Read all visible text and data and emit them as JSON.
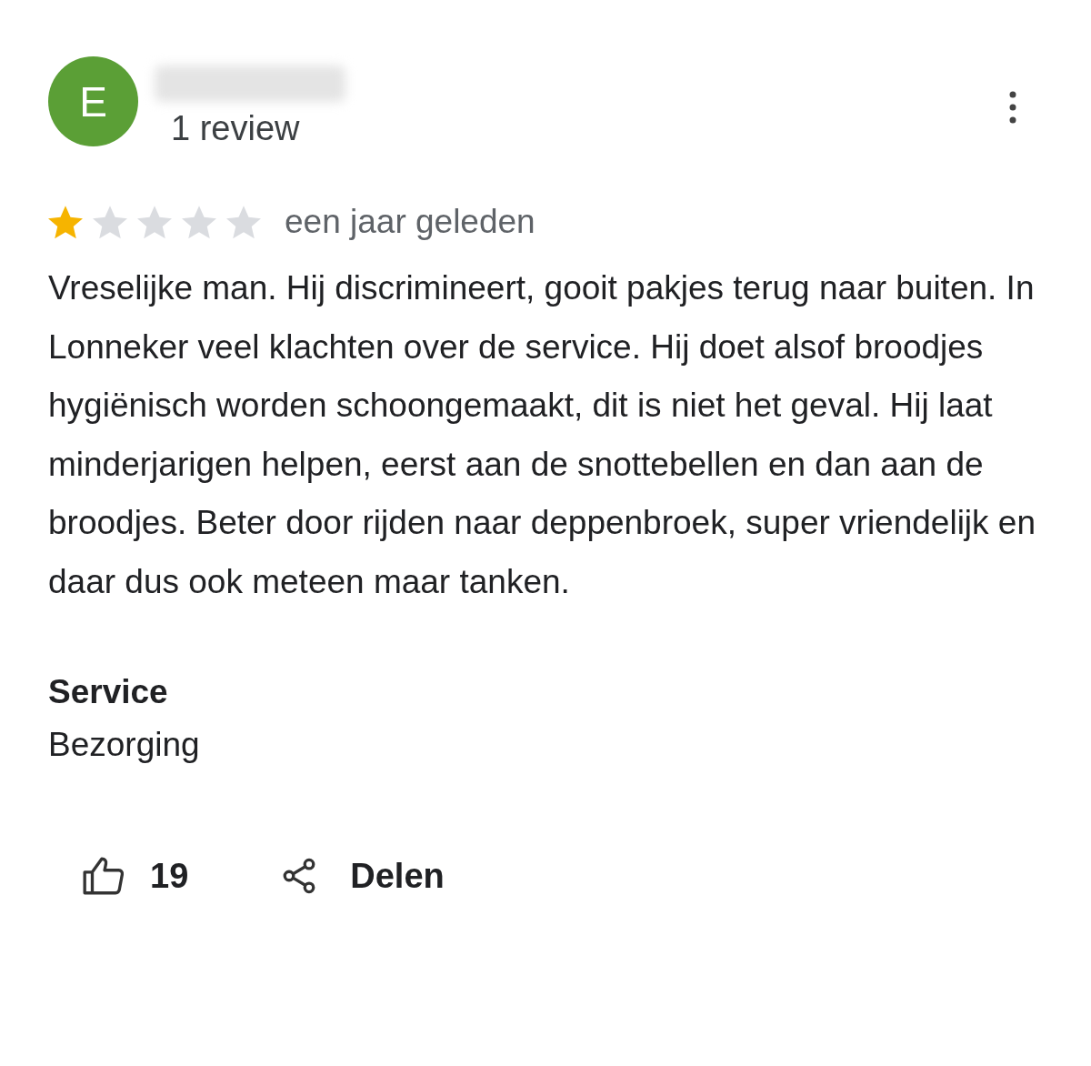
{
  "review": {
    "avatar_letter": "E",
    "review_count": "1 review",
    "stars": 1,
    "time": "een jaar geleden",
    "text": "Vreselijke man. Hij discrimineert, gooit pakjes terug naar buiten. In Lonneker veel klachten over de service. Hij doet alsof broodjes hygiënisch worden schoongemaakt, dit is niet het geval. Hij laat minderjarigen helpen, eerst aan de snottebellen en dan aan de broodjes. Beter door rijden naar deppenbroek, super vriendelijk en daar dus ook meteen maar tanken.",
    "attributes": [
      {
        "label": "Service",
        "value": "Bezorging"
      }
    ],
    "likes": "19",
    "share_label": "Delen"
  }
}
